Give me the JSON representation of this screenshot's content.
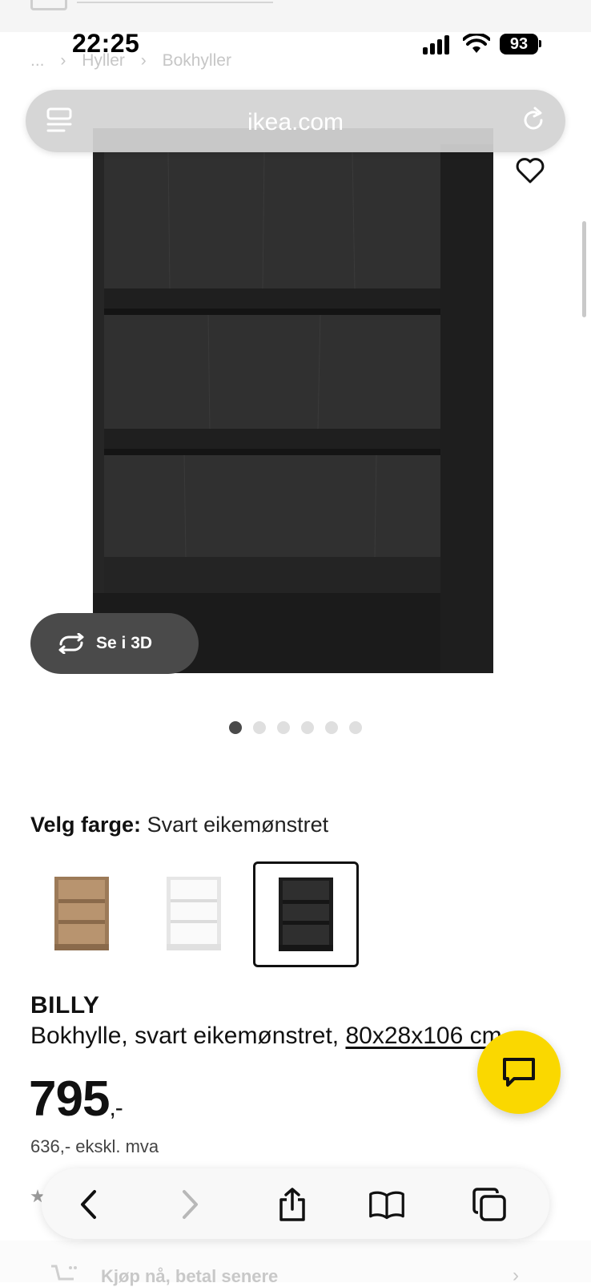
{
  "status": {
    "time": "22:25",
    "battery": "93"
  },
  "breadcrumb": [
    "...",
    "›",
    "Hyller",
    "›",
    "Bokhyller"
  ],
  "browser": {
    "url": "ikea.com"
  },
  "product": {
    "view3d_label": "Se i 3D",
    "image_count": 6,
    "active_image": 1,
    "color_label": "Velg farge:",
    "color_value": "Svart eikemønstret",
    "swatches": [
      {
        "name": "brown-oak",
        "color": "#b08a66",
        "selected": false
      },
      {
        "name": "white",
        "color": "#f2f2f2",
        "selected": false
      },
      {
        "name": "black-oak",
        "color": "#2b2b2b",
        "selected": true
      }
    ],
    "name": "BILLY",
    "description": "Bokhylle, svart eikemønstret, ",
    "dimensions": "80x28x106 cm",
    "price_main": "795",
    "price_suffix": ",-",
    "price_ex_vat": "636,- ekskl. mva",
    "buy_later": "Kjøp nå, betal senere"
  },
  "colors": {
    "chat_button": "#fad800",
    "dark_button": "#4a4a4a"
  }
}
